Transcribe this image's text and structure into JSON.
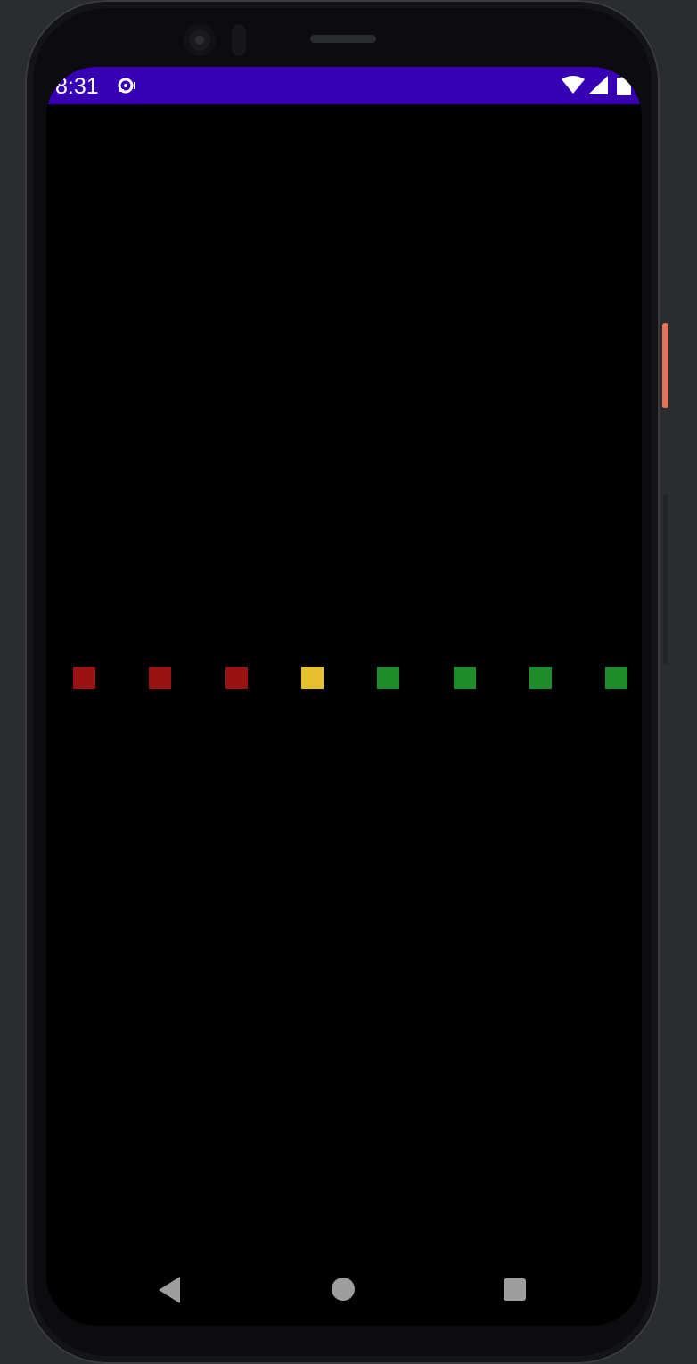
{
  "status_bar": {
    "time": "8:31",
    "background_color": "#3700b3",
    "icons": [
      "media-notification-icon",
      "wifi-icon",
      "cellular-signal-icon",
      "battery-icon"
    ]
  },
  "app": {
    "background_color": "#000000",
    "indicators": [
      {
        "name": "indicator-1",
        "color": "#9a1111",
        "state": "red"
      },
      {
        "name": "indicator-2",
        "color": "#9a1111",
        "state": "red"
      },
      {
        "name": "indicator-3",
        "color": "#9a1111",
        "state": "red"
      },
      {
        "name": "indicator-4",
        "color": "#e6c02e",
        "state": "yellow"
      },
      {
        "name": "indicator-5",
        "color": "#1e8c28",
        "state": "green"
      },
      {
        "name": "indicator-6",
        "color": "#1e8c28",
        "state": "green"
      },
      {
        "name": "indicator-7",
        "color": "#1e8c28",
        "state": "green"
      },
      {
        "name": "indicator-8",
        "color": "#1e8c28",
        "state": "green"
      }
    ]
  },
  "navigation_bar": {
    "icon_color": "#9e9e9e",
    "buttons": [
      "back-button",
      "home-button",
      "recents-button"
    ]
  },
  "device": {
    "frame_color": "#0c0c0e",
    "accent_button_color": "#e0765c"
  }
}
